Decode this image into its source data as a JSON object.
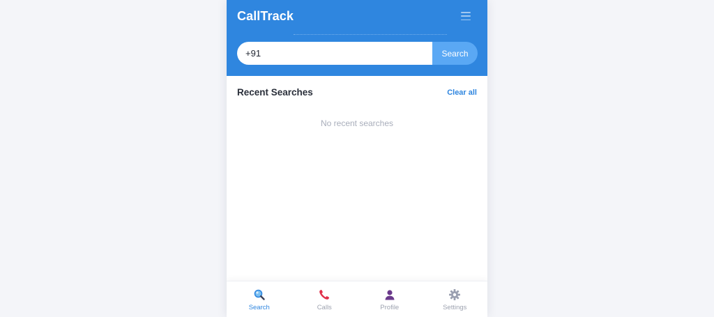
{
  "app": {
    "title": "CallTrack"
  },
  "search": {
    "value": "+91",
    "button_label": "Search"
  },
  "recent": {
    "title": "Recent Searches",
    "clear_label": "Clear all",
    "empty_text": "No recent searches"
  },
  "nav": {
    "items": [
      {
        "label": "Search",
        "icon": "search-icon",
        "active": true
      },
      {
        "label": "Calls",
        "icon": "phone-icon",
        "active": false
      },
      {
        "label": "Profile",
        "icon": "user-icon",
        "active": false
      },
      {
        "label": "Settings",
        "icon": "gear-icon",
        "active": false
      }
    ]
  },
  "colors": {
    "primary": "#2f86df",
    "search_button": "#5aa8f4",
    "calls_icon": "#e0304a",
    "profile_icon": "#6b3a8c",
    "settings_icon": "#9a9fb0",
    "background": "#f4f5f9"
  }
}
